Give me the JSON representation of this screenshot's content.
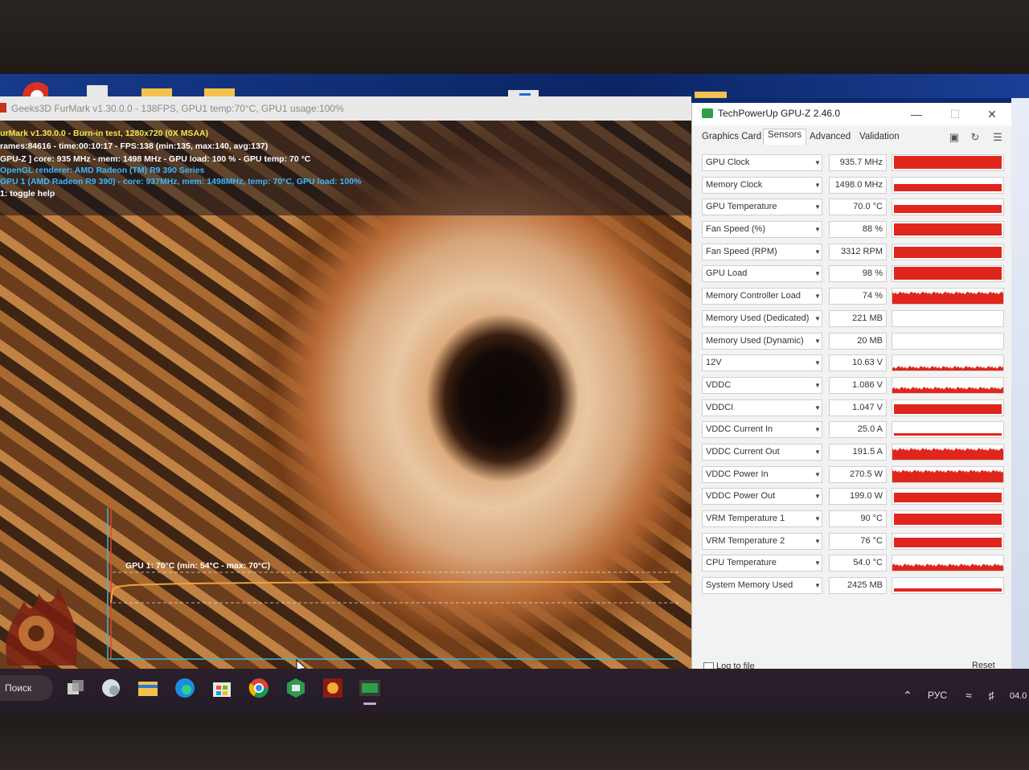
{
  "furmark": {
    "window_title": "Geeks3D FurMark v1.30.0.0 - 138FPS, GPU1 temp:70°C, GPU1 usage:100%",
    "overlay": {
      "line1": "urMark v1.30.0.0 - Burn-in test, 1280x720 (0X MSAA)",
      "line2": "rames:84616 - time:00:10:17 - FPS:138 (min:135, max:140, avg:137)",
      "line3": "GPU-Z ] core: 935 MHz - mem: 1498 MHz - GPU load: 100 % - GPU temp: 70 °C",
      "line4": "OpenGL renderer: AMD Radeon (TM) R9 390 Series",
      "line5": "GPU 1 (AMD Radeon R9 390) - core: 937MHz, mem: 1498MHz, temp: 70°C, GPU load: 100%",
      "line6": "1: toggle help"
    },
    "graph_label": "GPU 1: 70°C (min: 54°C - max: 70°C)"
  },
  "gpuz": {
    "title": "TechPowerUp GPU-Z 2.46.0",
    "window_buttons": {
      "minimize": "—",
      "maximize": "☐",
      "close": "✕"
    },
    "tabs": [
      "Graphics Card",
      "Sensors",
      "Advanced",
      "Validation"
    ],
    "active_tab": "Sensors",
    "toolbar_icons": [
      "camera-icon",
      "refresh-icon",
      "menu-icon"
    ],
    "sensors": [
      {
        "name": "GPU Clock",
        "value": "935.7 MHz",
        "level": 0.92,
        "pattern": "solid"
      },
      {
        "name": "Memory Clock",
        "value": "1498.0 MHz",
        "level": 0.55,
        "pattern": "solid"
      },
      {
        "name": "GPU Temperature",
        "value": "70.0 °C",
        "level": 0.6,
        "pattern": "solid"
      },
      {
        "name": "Fan Speed (%)",
        "value": "88 %",
        "level": 0.88,
        "pattern": "solid"
      },
      {
        "name": "Fan Speed (RPM)",
        "value": "3312 RPM",
        "level": 0.85,
        "pattern": "solid"
      },
      {
        "name": "GPU Load",
        "value": "98 %",
        "level": 0.95,
        "pattern": "solid"
      },
      {
        "name": "Memory Controller Load",
        "value": "74 %",
        "level": 0.74,
        "pattern": "noisy"
      },
      {
        "name": "Memory Used (Dedicated)",
        "value": "221 MB",
        "level": 0.0,
        "pattern": "empty"
      },
      {
        "name": "Memory Used (Dynamic)",
        "value": "20 MB",
        "level": 0.0,
        "pattern": "empty"
      },
      {
        "name": "12V",
        "value": "10.63 V",
        "level": 0.18,
        "pattern": "noisy"
      },
      {
        "name": "VDDC",
        "value": "1.086 V",
        "level": 0.3,
        "pattern": "noisy"
      },
      {
        "name": "VDDCI",
        "value": "1.047 V",
        "level": 0.7,
        "pattern": "solid"
      },
      {
        "name": "VDDC Current In",
        "value": "25.0 A",
        "level": 0.15,
        "pattern": "solid"
      },
      {
        "name": "VDDC Current Out",
        "value": "191.5 A",
        "level": 0.7,
        "pattern": "noisy"
      },
      {
        "name": "VDDC Power In",
        "value": "270.5 W",
        "level": 0.75,
        "pattern": "noisy"
      },
      {
        "name": "VDDC Power Out",
        "value": "199.0 W",
        "level": 0.7,
        "pattern": "solid"
      },
      {
        "name": "VRM Temperature 1",
        "value": "90 °C",
        "level": 0.85,
        "pattern": "solid"
      },
      {
        "name": "VRM Temperature 2",
        "value": "76 °C",
        "level": 0.7,
        "pattern": "solid"
      },
      {
        "name": "CPU Temperature",
        "value": "54.0 °C",
        "level": 0.35,
        "pattern": "noisy"
      },
      {
        "name": "System Memory Used",
        "value": "2425 MB",
        "level": 0.25,
        "pattern": "solid"
      }
    ],
    "footer": {
      "log_label": "Log to file",
      "reset_label": "Reset"
    }
  },
  "taskbar": {
    "search_label": "Поиск",
    "language": "РУС",
    "clock": "04.0",
    "accent_color": "#d9a3d8"
  },
  "colors": {
    "sensor_bar": "#e0261c",
    "furmark_title_text": "#8a8a8a",
    "overlay_yellow": "#f2e84a",
    "overlay_blue": "#39b8ff",
    "graph_line": "#f0a23a"
  }
}
